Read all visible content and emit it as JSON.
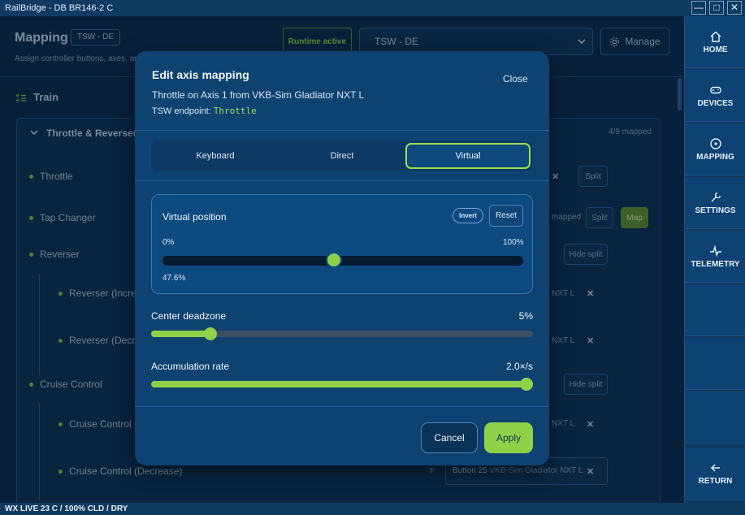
{
  "window": {
    "title": "RailBridge - DB BR146-2 C",
    "min": "—",
    "max": "□",
    "close": "✕"
  },
  "statusbar": {
    "text": "WX LIVE 23 C / 100% CLD / DRY"
  },
  "nav": {
    "home": "HOME",
    "devices": "DEVICES",
    "mapping": "MAPPING",
    "settings": "SETTINGS",
    "telemetry": "TELEMETRY",
    "return": "RETURN"
  },
  "page": {
    "title": "Mapping",
    "pill": "TSW - DE",
    "subtitle": "Assign controller buttons, axes, an",
    "runtime": "Runtime active",
    "profile": "TSW - DE",
    "manage": "Manage"
  },
  "train": {
    "label": "Train"
  },
  "group": {
    "title": "Throttle & Reverser",
    "count": "4/9 mapped",
    "rows": {
      "throttle": "Throttle",
      "tap_changer": "Tap Changer",
      "reverser": "Reverser",
      "reverser_inc": "Reverser (Incre",
      "reverser_dec": "Reverser (Decr",
      "cruise": "Cruise Control",
      "cruise_inc": "Cruise Control (",
      "cruise_dec": "Cruise Control (Decrease)"
    },
    "bg": {
      "split": "Split",
      "mapped": "mapped",
      "map": "Map",
      "hide_split": "Hide split",
      "nxt": "NXT L",
      "x": "✕",
      "f": "F",
      "binding_button": "Button 25",
      "binding_device": "VKB-Sim Gladiator NXT L"
    }
  },
  "modal": {
    "title": "Edit axis mapping",
    "close": "Close",
    "subtitle": "Throttle on Axis 1 from VKB-Sim Gladiator NXT L",
    "endpoint_label": "TSW endpoint:",
    "endpoint_value": "Throttle",
    "tabs": [
      "Keyboard",
      "Direct",
      "Virtual"
    ],
    "active_tab": "Virtual",
    "virtual": {
      "title": "Virtual position",
      "invert": "Invert",
      "reset": "Reset",
      "min_label": "0%",
      "max_label": "100%",
      "value_label": "47.6%",
      "value": 0.476
    },
    "deadzone": {
      "label": "Center deadzone",
      "value_label": "5%",
      "fraction": 0.155
    },
    "accumulation": {
      "label": "Accumulation rate",
      "value_label": "2.0×/s",
      "fraction": 1.0
    },
    "cancel": "Cancel",
    "apply": "Apply"
  },
  "colors": {
    "accent": "#8fd24a",
    "panel": "#0e4271",
    "background": "#0b2c4b"
  }
}
